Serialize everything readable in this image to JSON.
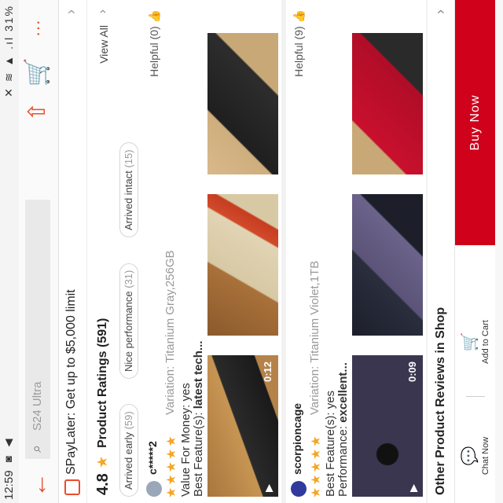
{
  "status_bar": {
    "time": "12:59",
    "battery": "31%"
  },
  "top_bar": {
    "search_placeholder": "S24 Ultra"
  },
  "promo": {
    "text": "SPayLater: Get up to $5,000 limit"
  },
  "ratings": {
    "score": "4.8",
    "title": "Product Ratings (591)",
    "view_all": "View All",
    "chips": [
      {
        "label": "Arrived early",
        "count": "(59)"
      },
      {
        "label": "Nice performance",
        "count": "(31)"
      },
      {
        "label": "Arrived intact",
        "count": "(15)"
      }
    ]
  },
  "reviews": [
    {
      "user": "c*****2",
      "helpful": "Helpful (0)",
      "variation": "Variation: Titanium Gray,256GB",
      "line1": "Value For Money: yes",
      "line2_label": "Best Feature(s):",
      "line2_text": "latest tech...",
      "rating": 5,
      "duration": "0:12"
    },
    {
      "user": "scorpioncage",
      "helpful": "Helpful (9)",
      "variation": "Variation: Titanium Violet,1TB",
      "line1": "Best Feature(s): yes",
      "line2_label": "Performance:",
      "line2_text": "excellent...",
      "rating": 5,
      "duration": "0:09"
    }
  ],
  "other_reviews": {
    "title": "Other Product Reviews in Shop"
  },
  "action_bar": {
    "chat_label": "Chat Now",
    "cart_label": "Add to Cart",
    "buy_label": "Buy Now"
  },
  "colors": {
    "accent": "#e94d2e",
    "buy": "#d0011b",
    "star": "#f5a623"
  },
  "icons": [
    "back-arrow-icon",
    "search-icon",
    "share-icon",
    "cart-icon",
    "more-icon",
    "star-icon",
    "helpful-thumb-icon",
    "chat-icon",
    "add-cart-icon"
  ]
}
